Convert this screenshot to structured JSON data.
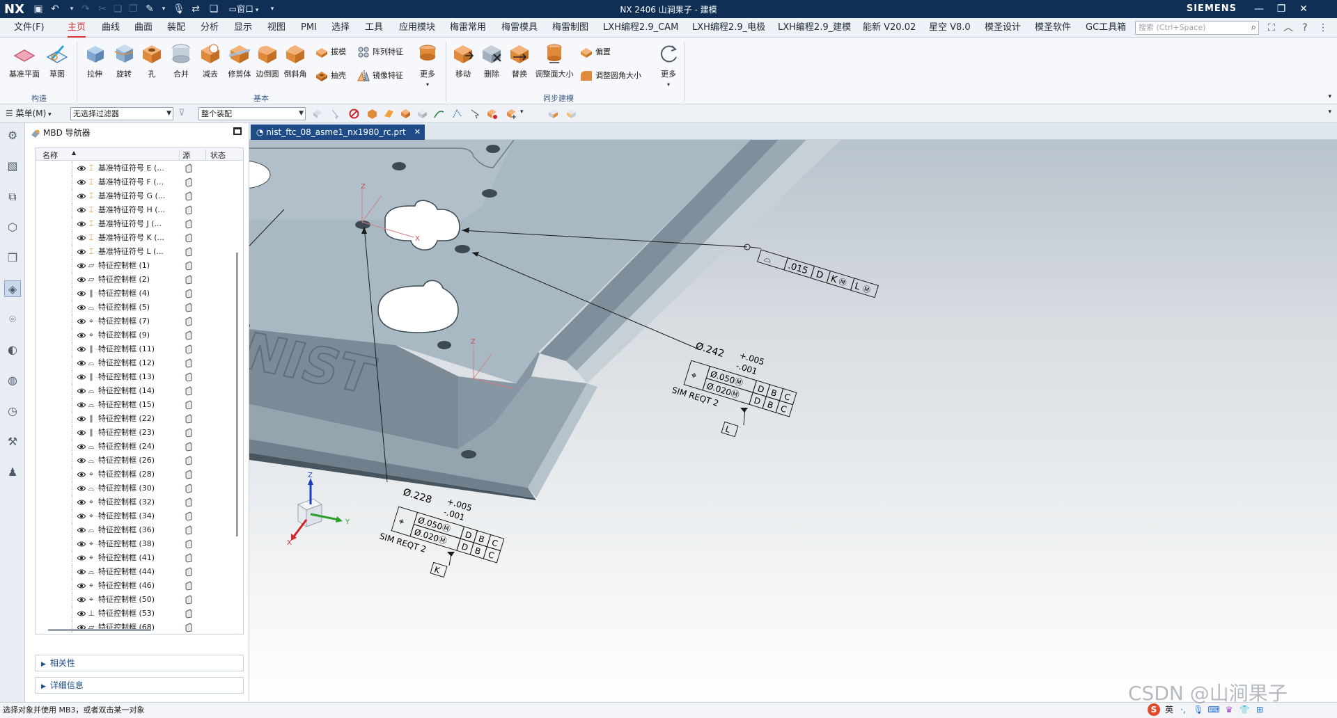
{
  "titlebar": {
    "logo": "NX",
    "title": "NX 2406 山涧果子 - 建模",
    "window_menu": "窗口",
    "brand": "SIEMENS",
    "minimize": "—",
    "restore": "❐",
    "close": "✕"
  },
  "menubar": {
    "items": [
      "文件(F)",
      "主页",
      "曲线",
      "曲面",
      "装配",
      "分析",
      "显示",
      "视图",
      "PMI",
      "选择",
      "工具",
      "应用模块",
      "梅雷常用",
      "梅雷模具",
      "梅雷制图",
      "LXH编程2.9_CAM",
      "LXH编程2.9_电极",
      "LXH编程2.9_建模",
      "能新 V20.02",
      "星空 V8.0",
      "模圣设计",
      "模圣软件",
      "GC工具箱"
    ],
    "active": "主页",
    "search_placeholder": "搜索 (Ctrl+Space)"
  },
  "ribbon": {
    "buttons": {
      "datum_plane": "基准平面",
      "sketch": "草图",
      "extrude": "拉伸",
      "revolve": "旋转",
      "hole": "孔",
      "unite": "合并",
      "subtract": "减去",
      "trim_body": "修剪体",
      "edge_blend": "边倒圆",
      "chamfer": "倒斜角",
      "draft": "拔模",
      "shell": "抽壳",
      "pattern_feature": "阵列特征",
      "mirror_feature": "镜像特征",
      "more_basic": "更多",
      "move": "移动",
      "delete": "删除",
      "replace": "替换",
      "resize_face": "调整面大小",
      "offset": "偏置",
      "resize_blend": "调整圆角大小",
      "more_sync": "更多"
    },
    "groups": {
      "construct": "构造",
      "basic": "基本",
      "sync": "同步建模"
    }
  },
  "selbar": {
    "menu": "菜单(M)",
    "filter": "无选择过滤器",
    "scope": "整个装配"
  },
  "navigator": {
    "title": "MBD 导航器",
    "columns": {
      "name": "名称",
      "source": "源",
      "status": "状态"
    },
    "rows": [
      {
        "icon": "datum",
        "label": "基准特征符号 E (..."
      },
      {
        "icon": "datum",
        "label": "基准特征符号 F (..."
      },
      {
        "icon": "datum",
        "label": "基准特征符号 G (..."
      },
      {
        "icon": "datum",
        "label": "基准特征符号 H (..."
      },
      {
        "icon": "datum",
        "label": "基准特征符号 J (..."
      },
      {
        "icon": "datum",
        "label": "基准特征符号 K (..."
      },
      {
        "icon": "datum",
        "label": "基准特征符号 L (..."
      },
      {
        "icon": "flatness",
        "label": "特征控制框 (1)"
      },
      {
        "icon": "flatness",
        "label": "特征控制框 (2)"
      },
      {
        "icon": "parallel",
        "label": "特征控制框 (4)"
      },
      {
        "icon": "profile",
        "label": "特征控制框 (5)"
      },
      {
        "icon": "position",
        "label": "特征控制框 (7)"
      },
      {
        "icon": "position",
        "label": "特征控制框 (9)"
      },
      {
        "icon": "parallel",
        "label": "特征控制框 (11)"
      },
      {
        "icon": "profile",
        "label": "特征控制框 (12)"
      },
      {
        "icon": "parallel",
        "label": "特征控制框 (13)"
      },
      {
        "icon": "profile",
        "label": "特征控制框 (14)"
      },
      {
        "icon": "profile",
        "label": "特征控制框 (15)"
      },
      {
        "icon": "parallel",
        "label": "特征控制框 (22)"
      },
      {
        "icon": "parallel",
        "label": "特征控制框 (23)"
      },
      {
        "icon": "profile",
        "label": "特征控制框 (24)"
      },
      {
        "icon": "profile",
        "label": "特征控制框 (26)"
      },
      {
        "icon": "position",
        "label": "特征控制框 (28)"
      },
      {
        "icon": "profile",
        "label": "特征控制框 (30)"
      },
      {
        "icon": "position",
        "label": "特征控制框 (32)"
      },
      {
        "icon": "position",
        "label": "特征控制框 (34)"
      },
      {
        "icon": "profile",
        "label": "特征控制框 (36)"
      },
      {
        "icon": "position",
        "label": "特征控制框 (38)"
      },
      {
        "icon": "position",
        "label": "特征控制框 (41)"
      },
      {
        "icon": "profile",
        "label": "特征控制框 (44)"
      },
      {
        "icon": "position",
        "label": "特征控制框 (46)"
      },
      {
        "icon": "position",
        "label": "特征控制框 (50)"
      },
      {
        "icon": "perpendicular",
        "label": "特征控制框 (53)"
      },
      {
        "icon": "flatness",
        "label": "特征控制框 (68)"
      }
    ],
    "panels": {
      "relations": "相关性",
      "details": "详细信息"
    }
  },
  "document": {
    "tab": "nist_ftc_08_asme1_nx1980_rc.prt"
  },
  "viewport": {
    "fcf_top": {
      "symbol": "⌓",
      "tol": ".015",
      "d1": "D",
      "d2": "K",
      "m2": "Ⓜ",
      "d3": "L",
      "m3": "Ⓜ"
    },
    "hole_right": {
      "diameter": "Ø.242",
      "upper": "+.005",
      "lower": "-.001",
      "row1": {
        "sym": "⌖",
        "tol": "Ø.050Ⓜ",
        "a": "D",
        "b": "B",
        "c": "C"
      },
      "row2": {
        "tol": "Ø.020Ⓜ",
        "a": "D",
        "b": "B",
        "c": "C"
      },
      "note": "SIM REQT 2",
      "datum": "L"
    },
    "hole_bottom": {
      "diameter": "Ø.228",
      "upper": "+.005",
      "lower": "-.001",
      "row1": {
        "sym": "⌖",
        "tol": "Ø.050Ⓜ",
        "a": "D",
        "b": "B",
        "c": "C"
      },
      "row2": {
        "tol": "Ø.020Ⓜ",
        "a": "D",
        "b": "B",
        "c": "C"
      },
      "note": "SIM REQT 2",
      "datum": "K"
    },
    "engraving": "NIST",
    "axis_labels": {
      "x": "X",
      "y": "Y",
      "z": "Z"
    }
  },
  "status": {
    "message": "选择对象并使用 MB3，或者双击某一对象",
    "watermark": "CSDN @山涧果子",
    "ime": "英"
  }
}
